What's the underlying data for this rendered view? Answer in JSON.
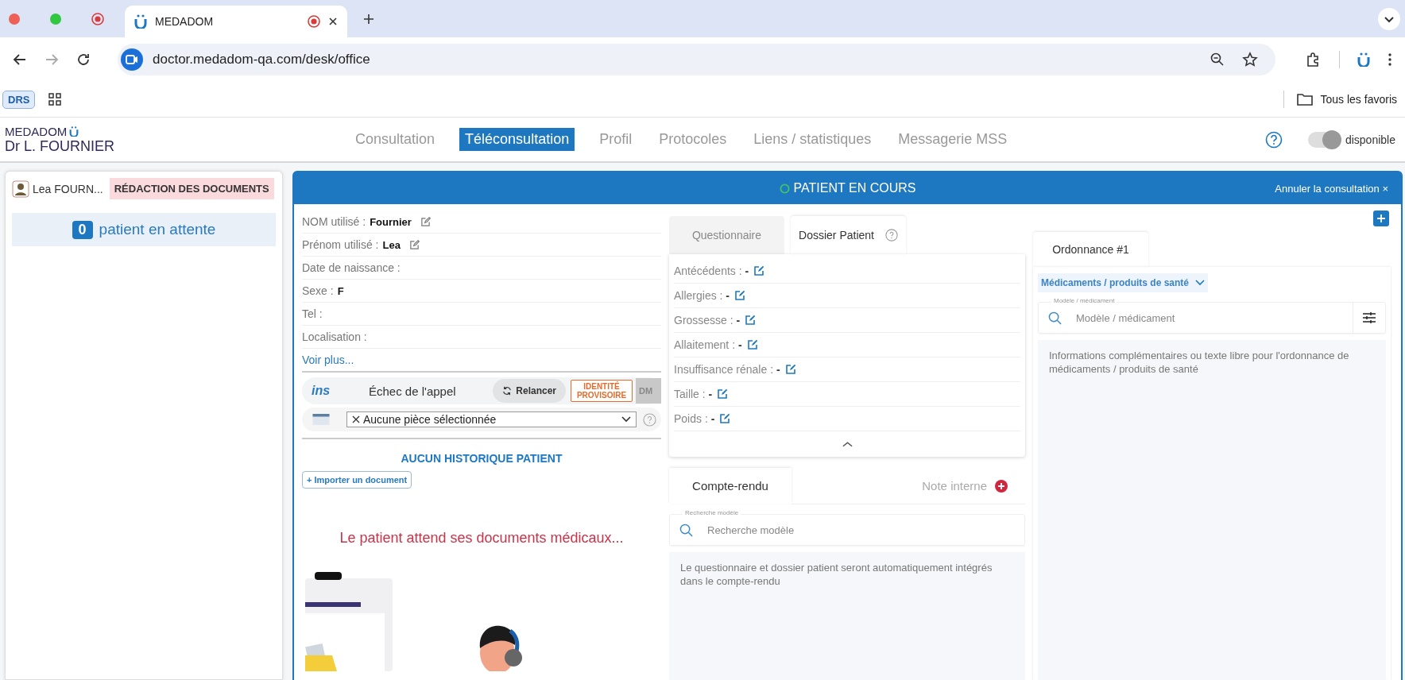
{
  "browser": {
    "tab_title": "MEDADOM",
    "url": "doctor.medadom-qa.com/desk/office",
    "bookmark_badge": "DRS",
    "favorites": "Tous les favoris"
  },
  "app": {
    "logo": "MEDADOM",
    "doctor": "Dr L. FOURNIER",
    "nav": [
      {
        "label": "Consultation",
        "selected": false
      },
      {
        "label": "Téléconsultation",
        "selected": true
      },
      {
        "label": "Profil",
        "selected": false
      },
      {
        "label": "Protocoles",
        "selected": false
      },
      {
        "label": "Liens / statistiques",
        "selected": false
      },
      {
        "label": "Messagerie MSS",
        "selected": false
      }
    ],
    "availability": {
      "label": "disponible",
      "on": true
    }
  },
  "sidebar": {
    "patient": {
      "name": "Lea FOURN...",
      "status": "RÉDACTION DES DOCUMENTS"
    },
    "waiting": {
      "count": "0",
      "label": "patient en attente"
    }
  },
  "consultation": {
    "title": "PATIENT EN COURS",
    "cancel": "Annuler la consultation ×",
    "identity": {
      "fields": [
        {
          "label": "NOM utilisé :",
          "value": "Fournier",
          "editable": true
        },
        {
          "label": "Prénom utilisé :",
          "value": "Lea",
          "editable": true
        },
        {
          "label": "Date de naissance :",
          "editable": false
        },
        {
          "label": "Sexe :",
          "value": "F",
          "editable": false
        },
        {
          "label": "Tel :",
          "editable": false
        },
        {
          "label": "Localisation :",
          "editable": false
        }
      ],
      "more": "Voir plus...",
      "ins": {
        "logo": "ins",
        "status": "Échec de l'appel",
        "retry": "Relancer",
        "badge": "IDENTITÉ PROVISOIRE",
        "dmp": "DM"
      },
      "document_select": {
        "value": "Aucune pièce sélectionnée"
      },
      "history": {
        "title": "AUCUN HISTORIQUE PATIENT",
        "import": "+ Importer un document"
      },
      "waiting_message": "Le patient attend ses documents médicaux..."
    }
  },
  "dossier": {
    "tabs": [
      {
        "label": "Questionnaire",
        "selected": false,
        "help": false
      },
      {
        "label": "Dossier Patient",
        "selected": true,
        "help": true
      }
    ],
    "items": [
      {
        "text": "Antécédents : **-**"
      },
      {
        "text": "Allergies : **-**"
      },
      {
        "text": "Grossesse : **-**"
      },
      {
        "text": "Allaitement : **-**"
      },
      {
        "text": "Insuffisance rénale : **-**"
      },
      {
        "text": "Taille : **-**"
      },
      {
        "text": "Poids : **-**"
      }
    ]
  },
  "report": {
    "tabs": [
      {
        "label": "Compte-rendu",
        "selected": true,
        "add": false
      },
      {
        "label": "Note interne",
        "selected": false,
        "add": true
      }
    ],
    "search": {
      "label": "Recherche modèle",
      "placeholder": "Recherche modèle"
    },
    "notes": {
      "placeholder": "Le questionnaire et dossier patient seront automatiquement intégrés dans le compte-rendu"
    }
  },
  "prescription": {
    "tabs": [
      {
        "label": "Ordonnance #1",
        "selected": true
      }
    ],
    "category": "Médicaments / produits de santé",
    "search": {
      "label": "Modèle / médicament",
      "placeholder": "Modèle / médicament"
    },
    "notes": {
      "placeholder": "Informations complémentaires ou texte libre pour l'ordonnance de médicaments / produits de santé"
    }
  }
}
